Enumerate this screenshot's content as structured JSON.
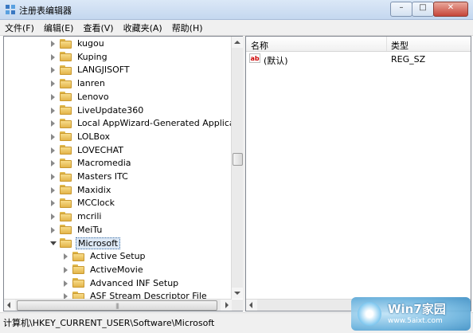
{
  "window": {
    "title": "注册表编辑器"
  },
  "menu": [
    "文件(F)",
    "编辑(E)",
    "查看(V)",
    "收藏夹(A)",
    "帮助(H)"
  ],
  "tree": {
    "items": [
      {
        "label": "kugou",
        "level": 1,
        "expanded": false,
        "selected": false
      },
      {
        "label": "Kuping",
        "level": 1,
        "expanded": false,
        "selected": false
      },
      {
        "label": "LANGJISOFT",
        "level": 1,
        "expanded": false,
        "selected": false
      },
      {
        "label": "lanren",
        "level": 1,
        "expanded": false,
        "selected": false
      },
      {
        "label": "Lenovo",
        "level": 1,
        "expanded": false,
        "selected": false
      },
      {
        "label": "LiveUpdate360",
        "level": 1,
        "expanded": false,
        "selected": false
      },
      {
        "label": "Local AppWizard-Generated Applications",
        "level": 1,
        "expanded": false,
        "selected": false
      },
      {
        "label": "LOLBox",
        "level": 1,
        "expanded": false,
        "selected": false
      },
      {
        "label": "LOVECHAT",
        "level": 1,
        "expanded": false,
        "selected": false
      },
      {
        "label": "Macromedia",
        "level": 1,
        "expanded": false,
        "selected": false
      },
      {
        "label": "Masters ITC",
        "level": 1,
        "expanded": false,
        "selected": false
      },
      {
        "label": "Maxidix",
        "level": 1,
        "expanded": false,
        "selected": false
      },
      {
        "label": "MCClock",
        "level": 1,
        "expanded": false,
        "selected": false
      },
      {
        "label": "mcrili",
        "level": 1,
        "expanded": false,
        "selected": false
      },
      {
        "label": "MeiTu",
        "level": 1,
        "expanded": false,
        "selected": false
      },
      {
        "label": "Microsoft",
        "level": 1,
        "expanded": true,
        "selected": true
      },
      {
        "label": "Active Setup",
        "level": 2,
        "expanded": false,
        "selected": false
      },
      {
        "label": "ActiveMovie",
        "level": 2,
        "expanded": false,
        "selected": false
      },
      {
        "label": "Advanced INF Setup",
        "level": 2,
        "expanded": false,
        "selected": false
      },
      {
        "label": "ASF Stream Descriptor File",
        "level": 2,
        "expanded": false,
        "selected": false
      }
    ]
  },
  "list": {
    "columns": [
      "名称",
      "类型"
    ],
    "rows": [
      {
        "name": "(默认)",
        "type": "REG_SZ"
      }
    ]
  },
  "status": {
    "path": "计算机\\HKEY_CURRENT_USER\\Software\\Microsoft"
  },
  "watermark": {
    "title": "Win7家园",
    "url": "www.5aixt.com"
  },
  "icons": {
    "app": "registry-editor-icon",
    "folder": "folder-icon",
    "value": "string-value-icon"
  },
  "colors": {
    "folder": "#e8bd50",
    "selection": "#dde8f5",
    "titlebar": "#c4d7ef"
  }
}
